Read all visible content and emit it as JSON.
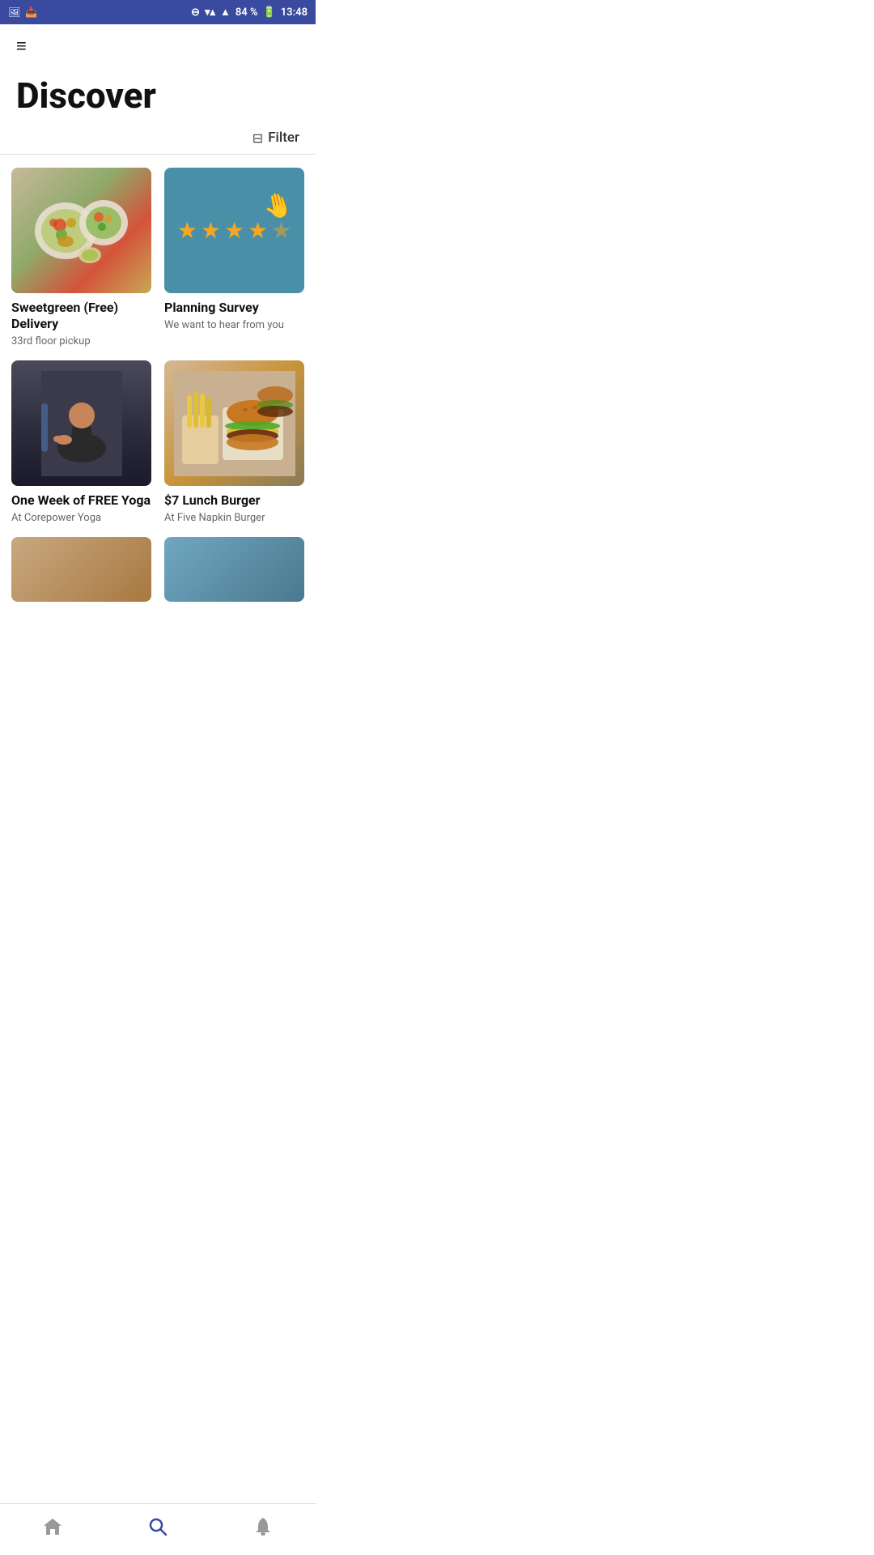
{
  "statusBar": {
    "battery": "84 %",
    "time": "13:48"
  },
  "header": {
    "menuIcon": "≡"
  },
  "pageTitle": "Discover",
  "filter": {
    "label": "Filter",
    "icon": "⊟"
  },
  "cards": [
    {
      "id": "sweetgreen",
      "title": "Sweetgreen (Free) Delivery",
      "subtitle": "33rd floor pickup",
      "imageType": "salad"
    },
    {
      "id": "planning-survey",
      "title": "Planning Survey",
      "subtitle": "We want to hear from you",
      "imageType": "survey"
    },
    {
      "id": "yoga",
      "title": "One Week of FREE Yoga",
      "subtitle": "At Corepower Yoga",
      "imageType": "yoga"
    },
    {
      "id": "burger",
      "title": "$7 Lunch Burger",
      "subtitle": "At Five Napkin Burger",
      "imageType": "burger"
    }
  ],
  "nav": {
    "home": "home",
    "search": "search",
    "notifications": "notifications"
  },
  "stars": [
    "★",
    "★",
    "★",
    "★",
    "★"
  ]
}
